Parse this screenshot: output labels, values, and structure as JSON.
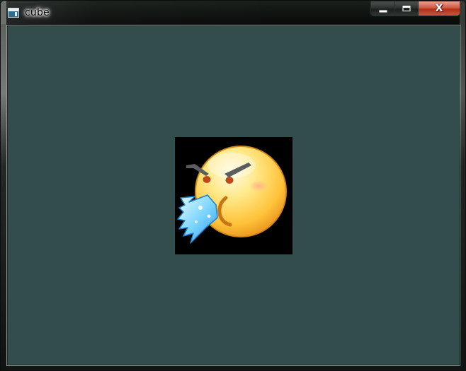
{
  "window": {
    "title": "cube",
    "icon": "app-window-icon",
    "controls": {
      "minimize_icon": "minimize-icon",
      "maximize_icon": "maximize-icon",
      "close_icon": "close-icon",
      "close_glyph": "X"
    }
  },
  "canvas": {
    "background_color": "#334d4d",
    "sprite": {
      "icon": "angry-emoji-icon",
      "background_color": "#000000"
    }
  }
}
